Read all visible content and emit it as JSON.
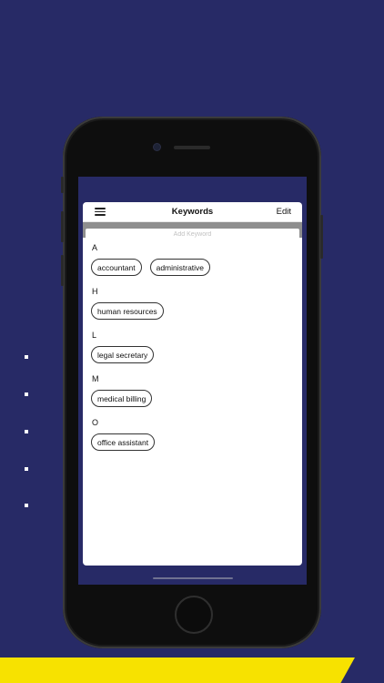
{
  "app": {
    "title": "Keywords",
    "edit_label": "Edit",
    "menu_icon": "hamburger-menu-icon"
  },
  "search": {
    "placeholder": "Add Keyword",
    "value": ""
  },
  "sections": [
    {
      "letter": "A",
      "keywords": [
        "accountant",
        "administrative"
      ]
    },
    {
      "letter": "H",
      "keywords": [
        "human resources"
      ]
    },
    {
      "letter": "L",
      "keywords": [
        "legal secretary"
      ]
    },
    {
      "letter": "M",
      "keywords": [
        "medical billing"
      ]
    },
    {
      "letter": "O",
      "keywords": [
        "office assistant"
      ]
    }
  ],
  "colors": {
    "background": "#272a66",
    "accent_strip": "#f7e200",
    "search_bar_frame": "#8e8e8e"
  }
}
